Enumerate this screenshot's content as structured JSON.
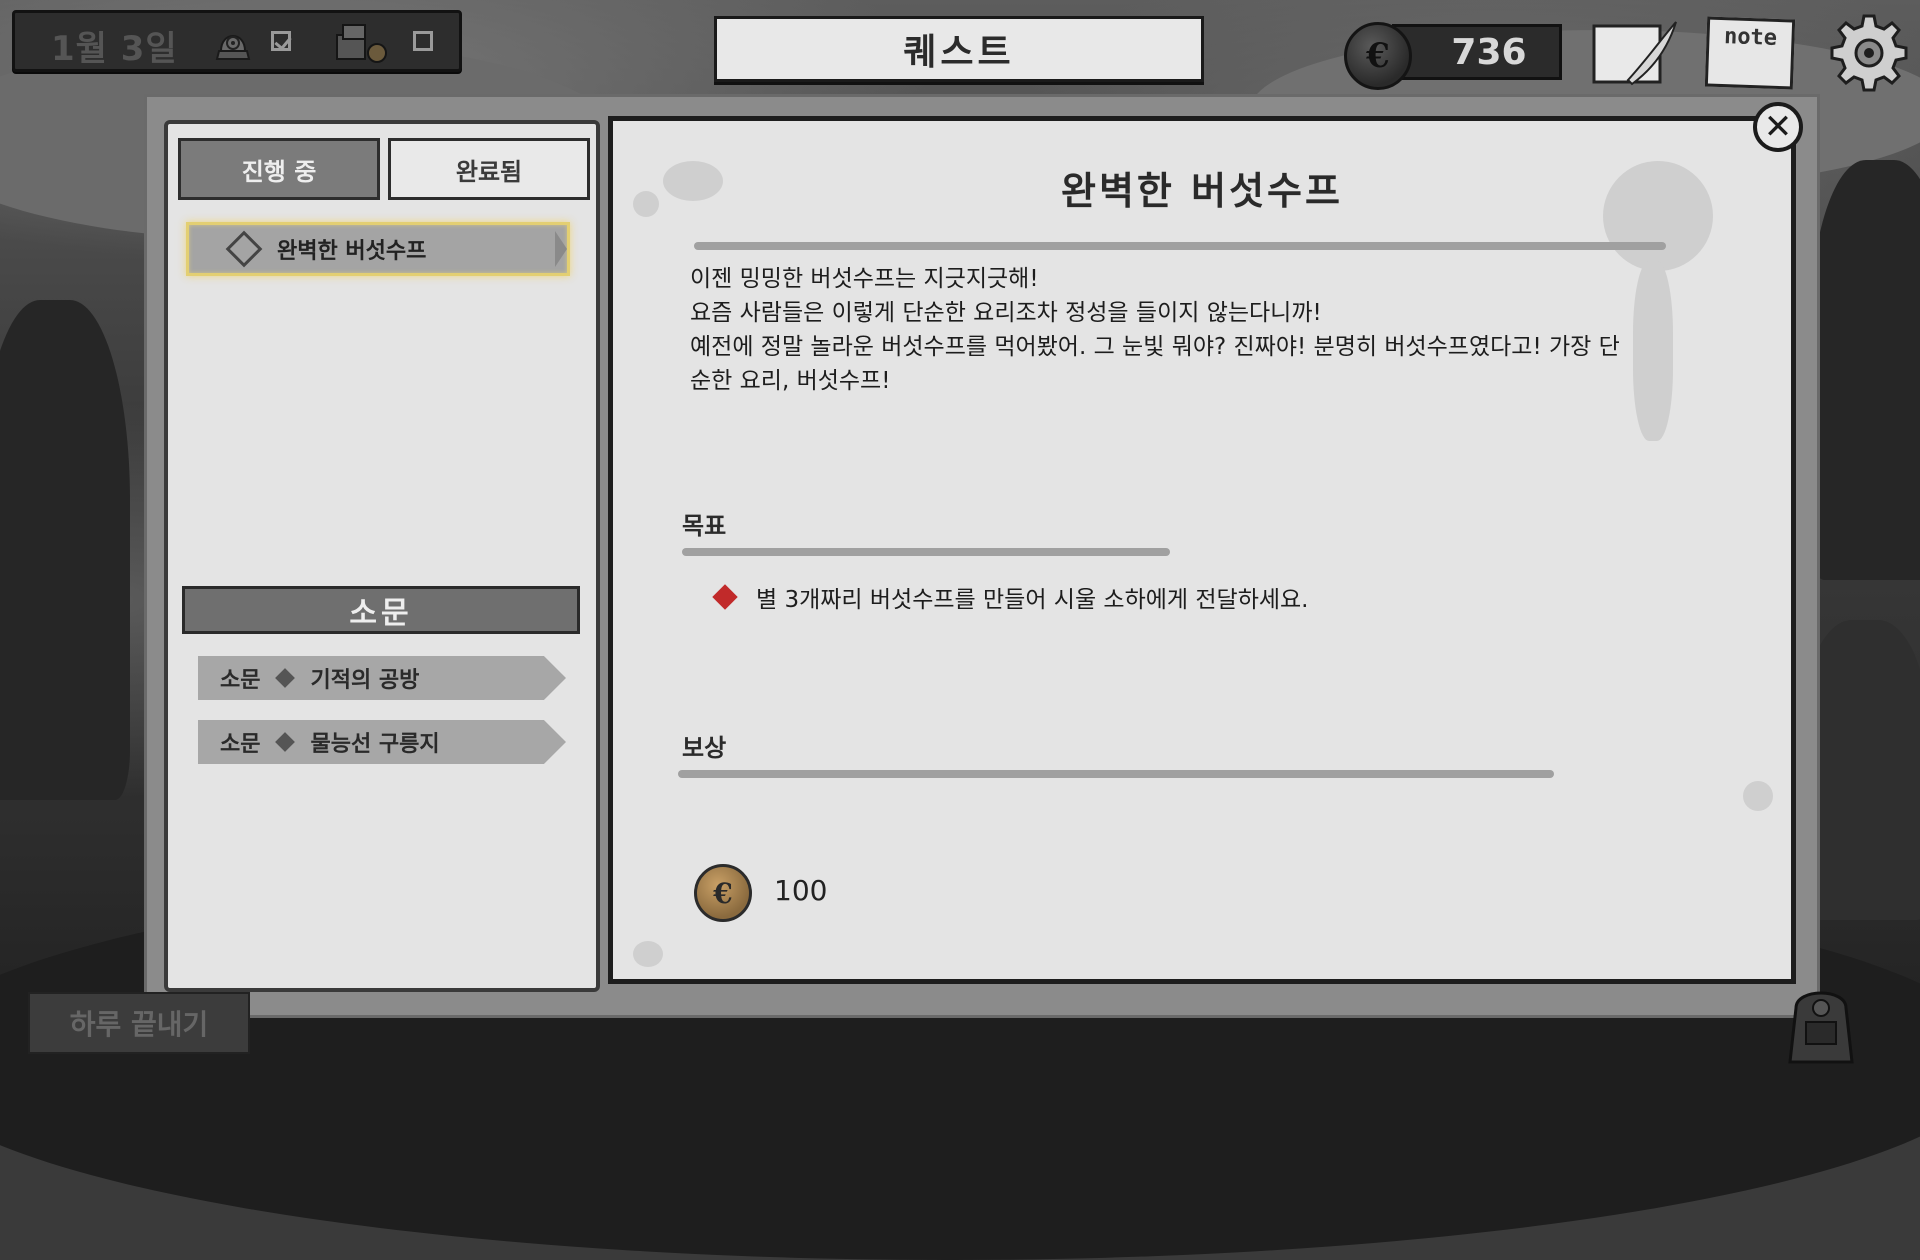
{
  "hud": {
    "date": "1월 3일",
    "title": "퀘스트",
    "coins": "736",
    "note_label": "note",
    "task1_checked": true,
    "task2_checked": false
  },
  "tabs": {
    "in_progress": "진행 중",
    "completed": "완료됨"
  },
  "quest_list": [
    {
      "title": "완벽한 버섯수프"
    }
  ],
  "rumors": {
    "header": "소문",
    "items": [
      {
        "tag": "소문",
        "title": "기적의 공방"
      },
      {
        "tag": "소문",
        "title": "물능선 구릉지"
      }
    ]
  },
  "detail": {
    "title": "완벽한 버섯수프",
    "story": [
      "이젠 밍밍한 버섯수프는 지긋지긋해!",
      "요즘 사람들은 이렇게 단순한 요리조차 정성을 들이지 않는다니까!",
      "예전에 정말 놀라운 버섯수프를 먹어봤어. 그 눈빛 뭐야? 진짜야! 분명히 버섯수프였다고! 가장 단",
      "순한 요리, 버섯수프!"
    ],
    "objective_label": "목표",
    "objective": "별 3개짜리 버섯수프를 만들어 시울 소하에게 전달하세요.",
    "reward_label": "보상",
    "reward_amount": "100"
  },
  "footer": {
    "end_day": "하루 끝내기"
  },
  "colors": {
    "highlight": "#e3cf72",
    "objective_marker": "#c12a2a",
    "panel": "#e4e4e4"
  },
  "icons": [
    "stamp-icon",
    "crate-icon",
    "coin-icon",
    "quill-scroll-icon",
    "note-icon",
    "gear-icon",
    "close-icon",
    "backpack-icon"
  ]
}
